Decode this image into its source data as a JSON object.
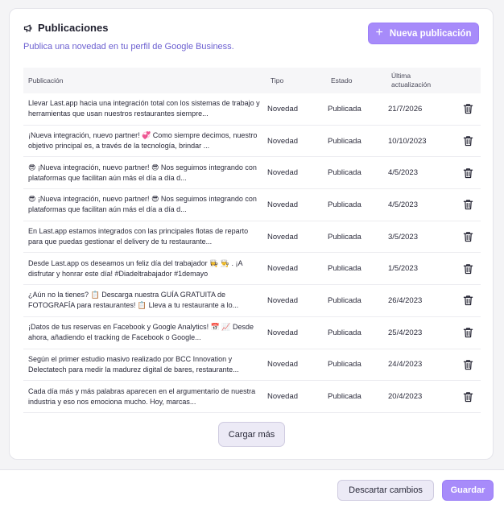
{
  "header": {
    "title": "Publicaciones",
    "subtitle": "Publica una novedad en tu perfil de Google Business.",
    "new_button_label": "Nueva publicación",
    "icon": "megaphone-icon"
  },
  "table": {
    "columns": {
      "publicacion": "Publicación",
      "tipo": "Tipo",
      "estado": "Estado",
      "fecha_line1": "Última",
      "fecha_line2": "actualización"
    },
    "rows": [
      {
        "text": "Llevar Last.app hacia una integración total con los sistemas de trabajo y herramientas que usan nuestros restaurantes siempre...",
        "tipo": "Novedad",
        "estado": "Publicada",
        "fecha": "21/7/2026"
      },
      {
        "text": "¡Nueva integración, nuevo partner! 💞 Como siempre decimos, nuestro objetivo principal es, a través de la tecnología, brindar ...",
        "tipo": "Novedad",
        "estado": "Publicada",
        "fecha": "10/10/2023"
      },
      {
        "text": "😎 ¡Nueva integración, nuevo partner! 😎 Nos seguimos integrando con plataformas que facilitan aún más el día a día d...",
        "tipo": "Novedad",
        "estado": "Publicada",
        "fecha": "4/5/2023"
      },
      {
        "text": "😎 ¡Nueva integración, nuevo partner! 😎 Nos seguimos integrando con plataformas que facilitan aún más el día a día d...",
        "tipo": "Novedad",
        "estado": "Publicada",
        "fecha": "4/5/2023"
      },
      {
        "text": "En Last.app estamos integrados con las principales flotas de reparto para que puedas gestionar el delivery de tu restaurante...",
        "tipo": "Novedad",
        "estado": "Publicada",
        "fecha": "3/5/2023"
      },
      {
        "text": "Desde Last.app os deseamos un feliz día del trabajador 👩‍🍳 👨‍🍳 . ¡A disfrutar y honrar este día! #Diadeltrabajador #1demayo",
        "tipo": "Novedad",
        "estado": "Publicada",
        "fecha": "1/5/2023"
      },
      {
        "text": "¿Aún no la tienes? 📋 Descarga nuestra GUÍA GRATUITA de FOTOGRAFÍA para restaurantes! 📋 Lleva a tu restaurante a lo...",
        "tipo": "Novedad",
        "estado": "Publicada",
        "fecha": "26/4/2023"
      },
      {
        "text": "¡Datos de tus reservas en Facebook y Google Analytics! 📅 📈 Desde ahora, añadiendo el tracking de Facebook o Google...",
        "tipo": "Novedad",
        "estado": "Publicada",
        "fecha": "25/4/2023"
      },
      {
        "text": "Según el primer estudio masivo realizado por BCC Innovation y Delectatech para medir la madurez digital de bares, restaurante...",
        "tipo": "Novedad",
        "estado": "Publicada",
        "fecha": "24/4/2023"
      },
      {
        "text": "Cada día más y más palabras aparecen en el argumentario de nuestra industria y eso nos emociona mucho. Hoy, marcas...",
        "tipo": "Novedad",
        "estado": "Publicada",
        "fecha": "20/4/2023"
      }
    ]
  },
  "load_more_label": "Cargar más",
  "footer": {
    "discard_label": "Descartar cambios",
    "save_label": "Guardar"
  },
  "colors": {
    "accent": "#a78bfa",
    "subtitle": "#6b5fd0"
  }
}
